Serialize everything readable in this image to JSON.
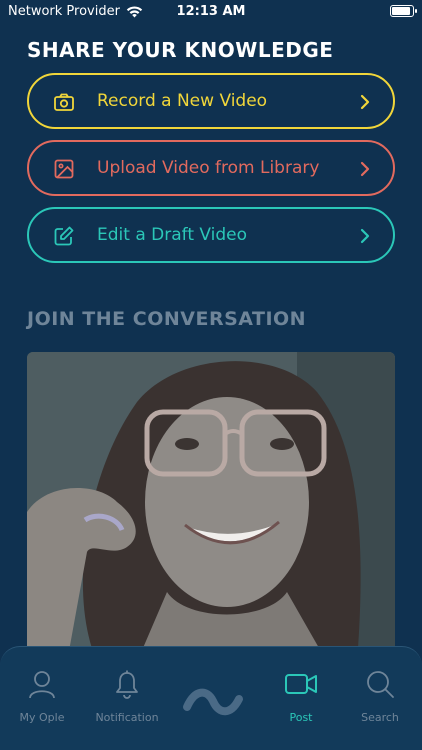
{
  "status_bar": {
    "carrier": "Network Provider",
    "time": "12:13 AM",
    "icons": [
      "wifi-icon",
      "battery-icon"
    ]
  },
  "share": {
    "title": "SHARE YOUR KNOWLEDGE",
    "buttons": [
      {
        "label": "Record a New Video",
        "icon": "camera-icon",
        "color": "#f1d63a"
      },
      {
        "label": "Upload Video from Library",
        "icon": "image-icon",
        "color": "#e26a5e"
      },
      {
        "label": "Edit a Draft Video",
        "icon": "edit-icon",
        "color": "#2bc7b8"
      }
    ]
  },
  "join": {
    "title": "JOIN THE CONVERSATION"
  },
  "tab_bar": {
    "tabs": [
      {
        "label": "My Ople",
        "icon": "user-icon"
      },
      {
        "label": "Notification",
        "icon": "bell-icon"
      },
      {
        "label": "",
        "icon": "wave-logo-icon"
      },
      {
        "label": "Post",
        "icon": "video-camera-icon",
        "active": true
      },
      {
        "label": "Search",
        "icon": "search-icon"
      }
    ]
  },
  "colors": {
    "background": "#0f3150",
    "tab_bar": "#123a5a",
    "accent_teal": "#2bc7b8",
    "muted": "#6f8599"
  }
}
